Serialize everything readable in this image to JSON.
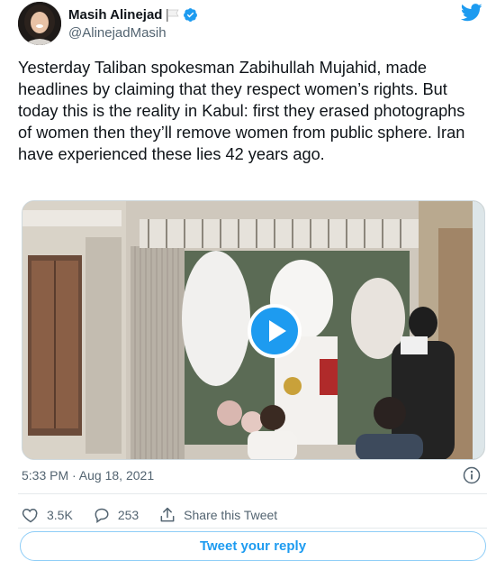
{
  "author": {
    "name": "Masih Alinejad",
    "handle": "@AlinejadMasih"
  },
  "tweet": {
    "text": "Yesterday Taliban spokesman Zabihullah Mujahid, made headlines by claiming that they respect women’s rights. But today this is the reality in Kabul: first they erased photographs of women then they’ll remove women from public sphere. Iran have experienced these lies 42 years ago.",
    "timestamp": "5:33 PM · Aug 18, 2021"
  },
  "actions": {
    "likes": "3.5K",
    "replies": "253",
    "share_label": "Share this Tweet"
  },
  "reply_button_label": "Tweet your reply",
  "colors": {
    "brand_blue": "#1d9bf0",
    "text": "#0f1419",
    "secondary_text": "#536471"
  },
  "icons": [
    "twitter-bird-icon",
    "verified-icon",
    "white-flag-icon",
    "play-icon",
    "info-icon",
    "heart-icon",
    "reply-bubble-icon",
    "share-icon"
  ]
}
